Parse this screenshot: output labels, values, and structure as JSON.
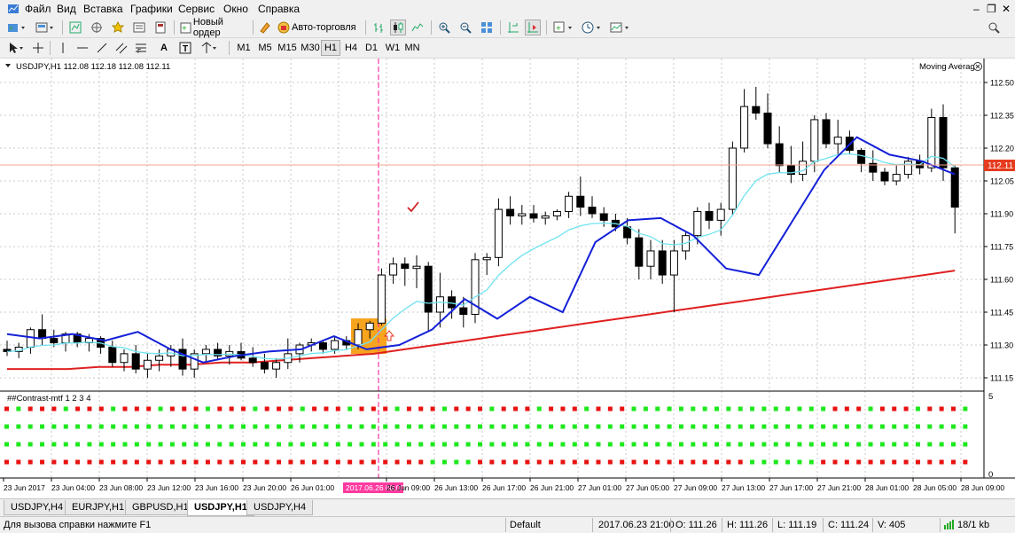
{
  "menu": [
    "Файл",
    "Вид",
    "Вставка",
    "Графики",
    "Сервис",
    "Окно",
    "Справка"
  ],
  "toolbar": {
    "new_order": "Новый ордер",
    "autotrading": "Авто-торговля"
  },
  "timeframes": [
    "M1",
    "M5",
    "M15",
    "M30",
    "H1",
    "H4",
    "D1",
    "W1",
    "MN"
  ],
  "active_timeframe": "H1",
  "chart": {
    "info": "USDJPY,H1  112.08 112.18 112.08 112.11",
    "indicator_label": "Moving Average",
    "sub_label": "##Contrast-mtf 1 2 3 4",
    "price_labels": [
      "112.50",
      "112.35",
      "112.20",
      "112.05",
      "111.90",
      "111.75",
      "111.60",
      "111.45",
      "111.30",
      "111.15"
    ],
    "current_price": "112.11",
    "sub_labels": [
      "5",
      "0"
    ],
    "time_labels": [
      "23 Jun 2017",
      "23 Jun 04:00",
      "23 Jun 08:00",
      "23 Jun 12:00",
      "23 Jun 16:00",
      "23 Jun 20:00",
      "26 Jun 01:00",
      "2017.06.26 08:00",
      "26 Jun 09:00",
      "26 Jun 13:00",
      "26 Jun 17:00",
      "26 Jun 21:00",
      "27 Jun 01:00",
      "27 Jun 05:00",
      "27 Jun 09:00",
      "27 Jun 13:00",
      "27 Jun 17:00",
      "27 Jun 21:00",
      "28 Jun 01:00",
      "28 Jun 05:00",
      "28 Jun 09:00"
    ]
  },
  "chart_data": {
    "type": "candlestick",
    "symbol": "USDJPY",
    "timeframe": "H1",
    "ylim": [
      111.15,
      112.55
    ],
    "candles": [
      [
        111.28,
        111.32,
        111.25,
        111.27
      ],
      [
        111.27,
        111.31,
        111.24,
        111.29
      ],
      [
        111.29,
        111.38,
        111.26,
        111.37
      ],
      [
        111.37,
        111.44,
        111.3,
        111.33
      ],
      [
        111.33,
        111.37,
        111.29,
        111.31
      ],
      [
        111.31,
        111.36,
        111.27,
        111.35
      ],
      [
        111.35,
        111.36,
        111.29,
        111.31
      ],
      [
        111.31,
        111.35,
        111.27,
        111.33
      ],
      [
        111.33,
        111.34,
        111.26,
        111.29
      ],
      [
        111.29,
        111.32,
        111.2,
        111.22
      ],
      [
        111.22,
        111.28,
        111.18,
        111.26
      ],
      [
        111.26,
        111.3,
        111.17,
        111.19
      ],
      [
        111.19,
        111.26,
        111.15,
        111.23
      ],
      [
        111.23,
        111.28,
        111.18,
        111.25
      ],
      [
        111.25,
        111.3,
        111.2,
        111.28
      ],
      [
        111.28,
        111.33,
        111.16,
        111.19
      ],
      [
        111.19,
        111.28,
        111.15,
        111.26
      ],
      [
        111.26,
        111.3,
        111.22,
        111.28
      ],
      [
        111.28,
        111.31,
        111.23,
        111.25
      ],
      [
        111.25,
        111.3,
        111.21,
        111.27
      ],
      [
        111.27,
        111.31,
        111.23,
        111.24
      ],
      [
        111.24,
        111.29,
        111.2,
        111.22
      ],
      [
        111.22,
        111.26,
        111.17,
        111.19
      ],
      [
        111.19,
        111.24,
        111.15,
        111.22
      ],
      [
        111.22,
        111.33,
        111.19,
        111.26
      ],
      [
        111.26,
        111.31,
        111.22,
        111.3
      ],
      [
        111.3,
        111.33,
        111.27,
        111.31
      ],
      [
        111.31,
        111.32,
        111.26,
        111.28
      ],
      [
        111.28,
        111.34,
        111.26,
        111.32
      ],
      [
        111.32,
        111.34,
        111.28,
        111.3
      ],
      [
        111.3,
        111.4,
        111.28,
        111.37
      ],
      [
        111.37,
        111.41,
        111.33,
        111.4
      ],
      [
        111.4,
        111.65,
        111.39,
        111.62
      ],
      [
        111.62,
        111.7,
        111.58,
        111.67
      ],
      [
        111.67,
        111.7,
        111.57,
        111.65
      ],
      [
        111.65,
        111.71,
        111.56,
        111.66
      ],
      [
        111.66,
        111.68,
        111.36,
        111.45
      ],
      [
        111.45,
        111.63,
        111.38,
        111.52
      ],
      [
        111.52,
        111.55,
        111.42,
        111.47
      ],
      [
        111.47,
        111.52,
        111.38,
        111.44
      ],
      [
        111.44,
        111.72,
        111.4,
        111.69
      ],
      [
        111.69,
        111.72,
        111.62,
        111.7
      ],
      [
        111.7,
        111.97,
        111.66,
        111.92
      ],
      [
        111.92,
        111.98,
        111.85,
        111.89
      ],
      [
        111.89,
        111.94,
        111.85,
        111.9
      ],
      [
        111.9,
        111.94,
        111.86,
        111.88
      ],
      [
        111.88,
        111.91,
        111.85,
        111.89
      ],
      [
        111.89,
        111.92,
        111.87,
        111.91
      ],
      [
        111.91,
        112.0,
        111.88,
        111.98
      ],
      [
        111.98,
        112.07,
        111.89,
        111.93
      ],
      [
        111.93,
        111.98,
        111.88,
        111.9
      ],
      [
        111.9,
        111.93,
        111.84,
        111.87
      ],
      [
        111.87,
        111.9,
        111.82,
        111.84
      ],
      [
        111.84,
        111.88,
        111.76,
        111.79
      ],
      [
        111.79,
        111.83,
        111.6,
        111.66
      ],
      [
        111.66,
        111.78,
        111.6,
        111.73
      ],
      [
        111.73,
        111.78,
        111.58,
        111.62
      ],
      [
        111.62,
        111.78,
        111.45,
        111.73
      ],
      [
        111.73,
        111.82,
        111.69,
        111.8
      ],
      [
        111.8,
        111.93,
        111.76,
        111.91
      ],
      [
        111.91,
        111.95,
        111.83,
        111.87
      ],
      [
        111.87,
        111.95,
        111.8,
        111.92
      ],
      [
        111.92,
        112.23,
        111.89,
        112.2
      ],
      [
        112.2,
        112.47,
        112.18,
        112.39
      ],
      [
        112.39,
        112.48,
        112.33,
        112.36
      ],
      [
        112.36,
        112.45,
        112.2,
        112.22
      ],
      [
        112.22,
        112.3,
        112.09,
        112.12
      ],
      [
        112.12,
        112.21,
        112.04,
        112.08
      ],
      [
        112.08,
        112.23,
        112.05,
        112.14
      ],
      [
        112.14,
        112.35,
        112.09,
        112.33
      ],
      [
        112.33,
        112.36,
        112.2,
        112.22
      ],
      [
        112.22,
        112.33,
        112.17,
        112.25
      ],
      [
        112.25,
        112.28,
        112.17,
        112.19
      ],
      [
        112.19,
        112.2,
        112.09,
        112.13
      ],
      [
        112.13,
        112.19,
        112.05,
        112.09
      ],
      [
        112.09,
        112.11,
        112.03,
        112.05
      ],
      [
        112.05,
        112.12,
        112.03,
        112.08
      ],
      [
        112.08,
        112.16,
        112.06,
        112.14
      ],
      [
        112.14,
        112.17,
        112.08,
        112.11
      ],
      [
        112.11,
        112.38,
        112.09,
        112.34
      ],
      [
        112.34,
        112.4,
        112.05,
        112.11
      ],
      [
        112.11,
        112.12,
        111.81,
        111.93
      ]
    ],
    "ma_slow": [
      111.19,
      111.19,
      111.19,
      111.2,
      111.2,
      111.21,
      111.21,
      111.22,
      111.22,
      111.23,
      111.24,
      111.25,
      111.26,
      111.28,
      111.3,
      111.32,
      111.34,
      111.36,
      111.38,
      111.4,
      111.42,
      111.44,
      111.46,
      111.48,
      111.5,
      111.52,
      111.54,
      111.56,
      111.58,
      111.6,
      111.62,
      111.64
    ],
    "ma_fast": [
      111.35,
      111.33,
      111.35,
      111.32,
      111.36,
      111.28,
      111.22,
      111.25,
      111.27,
      111.28,
      111.34,
      111.28,
      111.3,
      111.37,
      111.51,
      111.42,
      111.52,
      111.45,
      111.77,
      111.87,
      111.88,
      111.8,
      111.65,
      111.62,
      111.86,
      112.1,
      112.25,
      112.17,
      112.14,
      112.08
    ],
    "series_names": [
      "Moving Average"
    ]
  }
}
